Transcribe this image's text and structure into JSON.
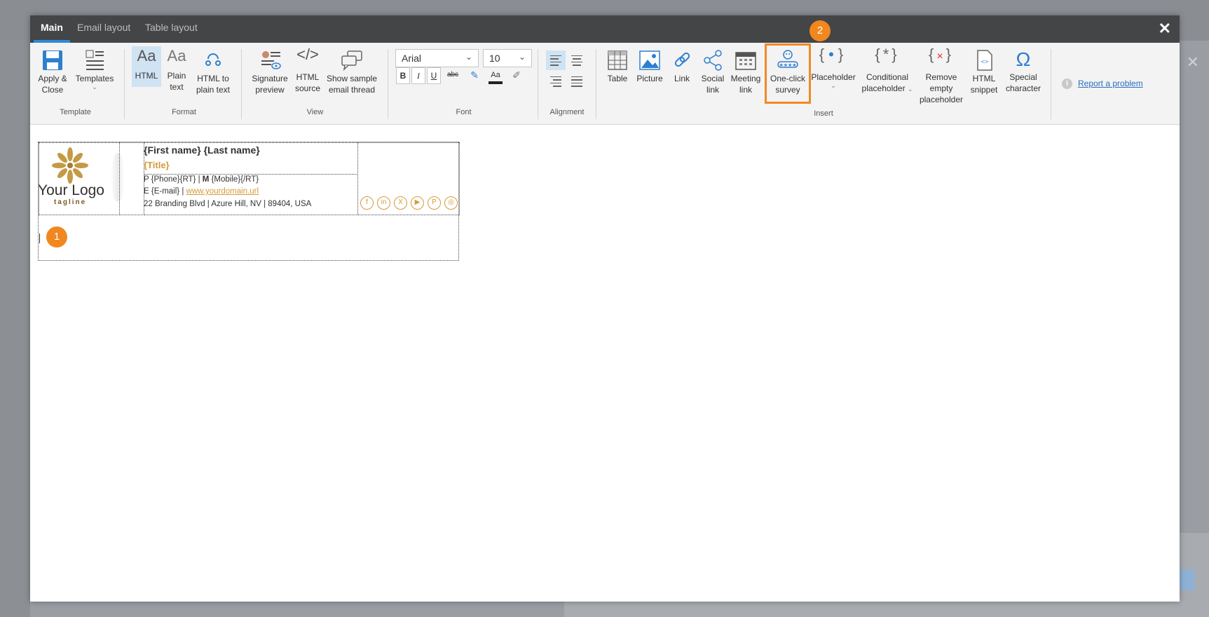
{
  "tabs": [
    {
      "label": "Main"
    },
    {
      "label": "Email layout"
    },
    {
      "label": "Table layout"
    }
  ],
  "close_glyph": "✕",
  "ribbon": {
    "template": {
      "group_label": "Template",
      "apply_close_line1": "Apply &",
      "apply_close_line2": "Close",
      "templates_label": "Templates"
    },
    "format": {
      "group_label": "Format",
      "html_label": "HTML",
      "plain_line1": "Plain",
      "plain_line2": "text",
      "html_to_plain_line1": "HTML to",
      "html_to_plain_line2": "plain text"
    },
    "view": {
      "group_label": "View",
      "sig_preview_line1": "Signature",
      "sig_preview_line2": "preview",
      "html_source_line1": "HTML",
      "html_source_line2": "source",
      "show_thread_line1": "Show sample",
      "show_thread_line2": "email thread"
    },
    "font": {
      "group_label": "Font",
      "family": "Arial",
      "size": "10",
      "bold": "B",
      "italic": "I",
      "underline": "U",
      "strike": "abc",
      "font_color": "Aa"
    },
    "alignment": {
      "group_label": "Alignment"
    },
    "insert": {
      "group_label": "Insert",
      "table": "Table",
      "picture": "Picture",
      "link": "Link",
      "social_line1": "Social",
      "social_line2": "link",
      "meeting_line1": "Meeting",
      "meeting_line2": "link",
      "survey_line1": "One-click",
      "survey_line2": "survey",
      "placeholder": "Placeholder",
      "conditional_line1": "Conditional",
      "conditional_line2": "placeholder",
      "remove_line1": "Remove",
      "remove_line2": "empty",
      "remove_line3": "placeholder",
      "snippet_line1": "HTML",
      "snippet_line2": "snippet",
      "special_line1": "Special",
      "special_line2": "character"
    },
    "report": "Report a problem"
  },
  "badges": {
    "one": "1",
    "two": "2"
  },
  "signature": {
    "logo_text": "Your Logo",
    "tagline": "tagline",
    "name": "{First name} {Last name}",
    "title": "{Title}",
    "phone_label": "P",
    "phone_value": " {Phone}{RT} | ",
    "mobile_label": "M",
    "mobile_value": " {Mobile}{/RT}",
    "email_prefix": "E {E-mail} | ",
    "website": "www.yourdomain.url",
    "address": "22 Branding Blvd | Azure Hill, NV | 89404, USA",
    "social": [
      {
        "name": "facebook-icon",
        "glyph": "f"
      },
      {
        "name": "linkedin-icon",
        "glyph": "in"
      },
      {
        "name": "x-icon",
        "glyph": "X"
      },
      {
        "name": "youtube-icon",
        "glyph": "▶"
      },
      {
        "name": "pinterest-icon",
        "glyph": "P"
      },
      {
        "name": "instagram-icon",
        "glyph": "◎"
      }
    ]
  },
  "colors": {
    "accent": "#f0871f",
    "brand_gold": "#d39b3b",
    "tab_underline": "#2e8ad8"
  }
}
